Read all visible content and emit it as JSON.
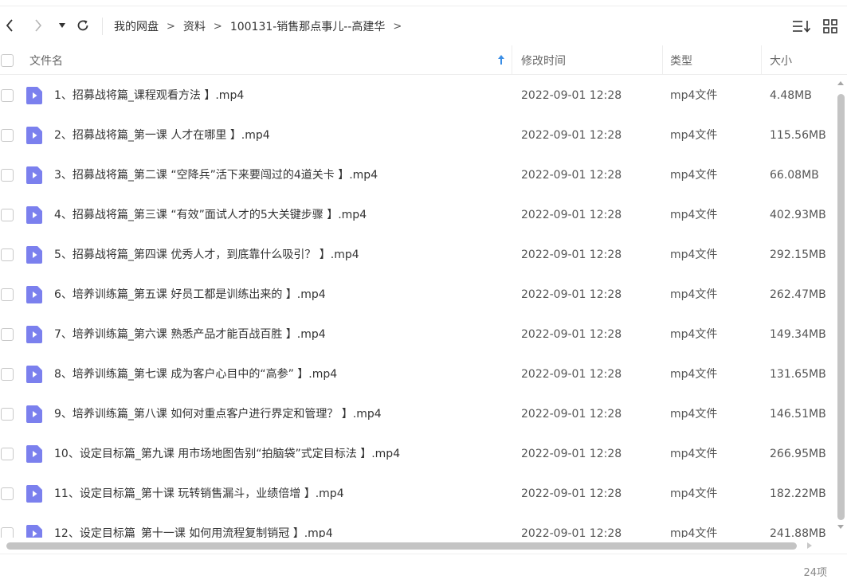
{
  "toolbar": {
    "breadcrumb": [
      "我的网盘",
      "资料",
      "100131-销售那点事儿--高建华"
    ],
    "separator": ">"
  },
  "columns": {
    "name": "文件名",
    "date": "修改时间",
    "type": "类型",
    "size": "大小"
  },
  "files": [
    {
      "name": "1、招募战将篇_课程观看方法 】.mp4",
      "date": "2022-09-01 12:28",
      "type": "mp4文件",
      "size": "4.48MB"
    },
    {
      "name": "2、招募战将篇_第一课 人才在哪里 】.mp4",
      "date": "2022-09-01 12:28",
      "type": "mp4文件",
      "size": "115.56MB"
    },
    {
      "name": "3、招募战将篇_第二课 “空降兵”活下来要闯过的4道关卡 】.mp4",
      "date": "2022-09-01 12:28",
      "type": "mp4文件",
      "size": "66.08MB"
    },
    {
      "name": "4、招募战将篇_第三课 “有效”面试人才的5大关键步骤 】.mp4",
      "date": "2022-09-01 12:28",
      "type": "mp4文件",
      "size": "402.93MB"
    },
    {
      "name": "5、招募战将篇_第四课 优秀人才，到底靠什么吸引？ 】.mp4",
      "date": "2022-09-01 12:28",
      "type": "mp4文件",
      "size": "292.15MB"
    },
    {
      "name": "6、培养训练篇_第五课 好员工都是训练出来的 】.mp4",
      "date": "2022-09-01 12:28",
      "type": "mp4文件",
      "size": "262.47MB"
    },
    {
      "name": "7、培养训练篇_第六课 熟悉产品才能百战百胜 】.mp4",
      "date": "2022-09-01 12:28",
      "type": "mp4文件",
      "size": "149.34MB"
    },
    {
      "name": "8、培养训练篇_第七课 成为客户心目中的“高参” 】.mp4",
      "date": "2022-09-01 12:28",
      "type": "mp4文件",
      "size": "131.65MB"
    },
    {
      "name": "9、培养训练篇_第八课 如何对重点客户进行界定和管理？ 】.mp4",
      "date": "2022-09-01 12:28",
      "type": "mp4文件",
      "size": "146.51MB"
    },
    {
      "name": "10、设定目标篇_第九课 用市场地图告别“拍脑袋”式定目标法 】.mp4",
      "date": "2022-09-01 12:28",
      "type": "mp4文件",
      "size": "266.95MB"
    },
    {
      "name": "11、设定目标篇_第十课 玩转销售漏斗，业绩倍增 】.mp4",
      "date": "2022-09-01 12:28",
      "type": "mp4文件",
      "size": "182.22MB"
    },
    {
      "name": "12、设定目标篇_第十一课 如何用流程复制销冠 】.mp4",
      "date": "2022-09-01 12:28",
      "type": "mp4文件",
      "size": "241.88MB"
    }
  ],
  "footer": {
    "count": "24项"
  },
  "colors": {
    "accent": "#3a8ee6",
    "file_icon": "#7b80ee",
    "scroll_thumb": "#c4c4c4"
  }
}
